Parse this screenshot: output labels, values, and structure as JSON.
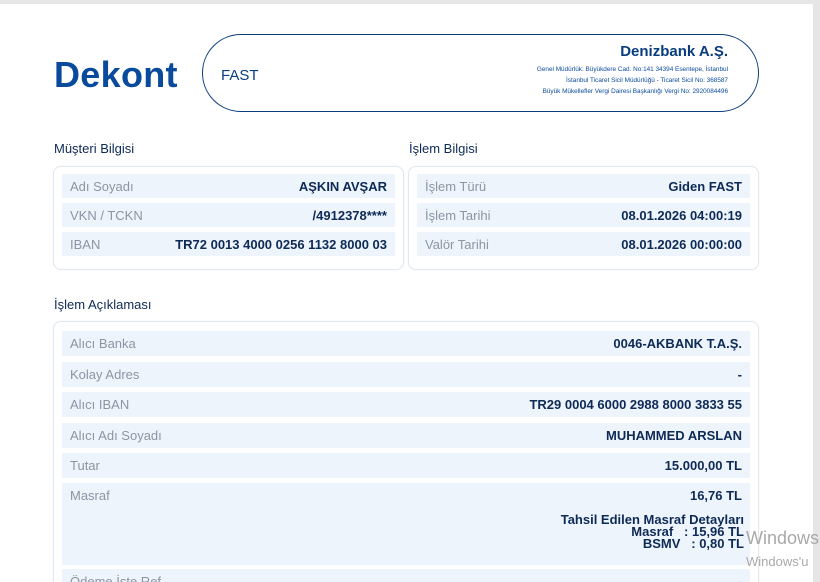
{
  "header": {
    "title": "Dekont",
    "transfer_type": "FAST",
    "bank_name": "Denizbank A.Ş.",
    "bank_lines": [
      "Genel Müdürlük: Büyükdere Cad. No:141 34394 Esentepe, İstanbul",
      "İstanbul Ticaret Sicil Müdürlüğü - Ticaret Sicil No: 368587",
      "Büyük Mükellefler Vergi Dairesi Başkanlığı Vergi No: 2920084496"
    ]
  },
  "customer": {
    "section_title": "Müşteri Bilgisi",
    "rows": [
      {
        "label": "Adı Soyadı",
        "value": "AŞKIN AVŞAR"
      },
      {
        "label": "VKN / TCKN",
        "value": "/4912378****"
      },
      {
        "label": "IBAN",
        "value": "TR72 0013 4000 0256 1132 8000 03"
      }
    ]
  },
  "transaction": {
    "section_title": "İşlem Bilgisi",
    "rows": [
      {
        "label": "İşlem Türü",
        "value": "Giden FAST"
      },
      {
        "label": "İşlem Tarihi",
        "value": "08.01.2026 04:00:19"
      },
      {
        "label": "Valör Tarihi",
        "value": "08.01.2026 00:00:00"
      }
    ]
  },
  "description": {
    "section_title": "İşlem Açıklaması",
    "rows": [
      {
        "label": "Alıcı Banka",
        "value": "0046-AKBANK T.A.Ş."
      },
      {
        "label": "Kolay Adres",
        "value": "-"
      },
      {
        "label": "Alıcı IBAN",
        "value": "TR29 0004 6000 2988 8000 3833 55"
      },
      {
        "label": "Alıcı Adı Soyadı",
        "value": "MUHAMMED ARSLAN"
      },
      {
        "label": "Tutar",
        "value": "15.000,00 TL"
      },
      {
        "label": "Masraf",
        "value": "16,76 TL"
      },
      {
        "label": "Ödeme İşte Ref",
        "value": "-"
      }
    ],
    "fee_details": {
      "title": "Tahsil Edilen Masraf Detayları",
      "masraf": "Masraf   : 15,96 TL",
      "bsmv": "BSMV   : 0,80 TL"
    }
  },
  "watermark": {
    "line1": "Windows",
    "line2": "Windows'u"
  }
}
